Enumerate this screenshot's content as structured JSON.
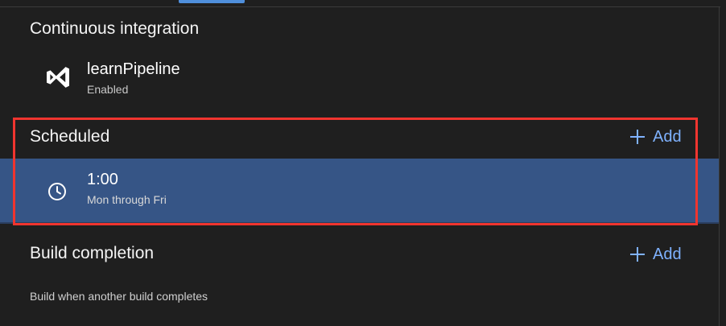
{
  "continuous_integration": {
    "title": "Continuous integration",
    "pipeline": {
      "icon": "visual-studio-icon",
      "name": "learnPipeline",
      "status": "Enabled"
    }
  },
  "scheduled": {
    "title": "Scheduled",
    "add_label": "Add",
    "items": [
      {
        "icon": "clock-icon",
        "time": "1:00",
        "days": "Mon through Fri"
      }
    ]
  },
  "build_completion": {
    "title": "Build completion",
    "add_label": "Add",
    "description": "Build when another build completes"
  },
  "colors": {
    "background": "#1f1f1f",
    "accent": "#7fb2ff",
    "selected_row": "#365586",
    "highlight_border": "#f0352f",
    "tab_indicator": "#4f8fdc"
  }
}
